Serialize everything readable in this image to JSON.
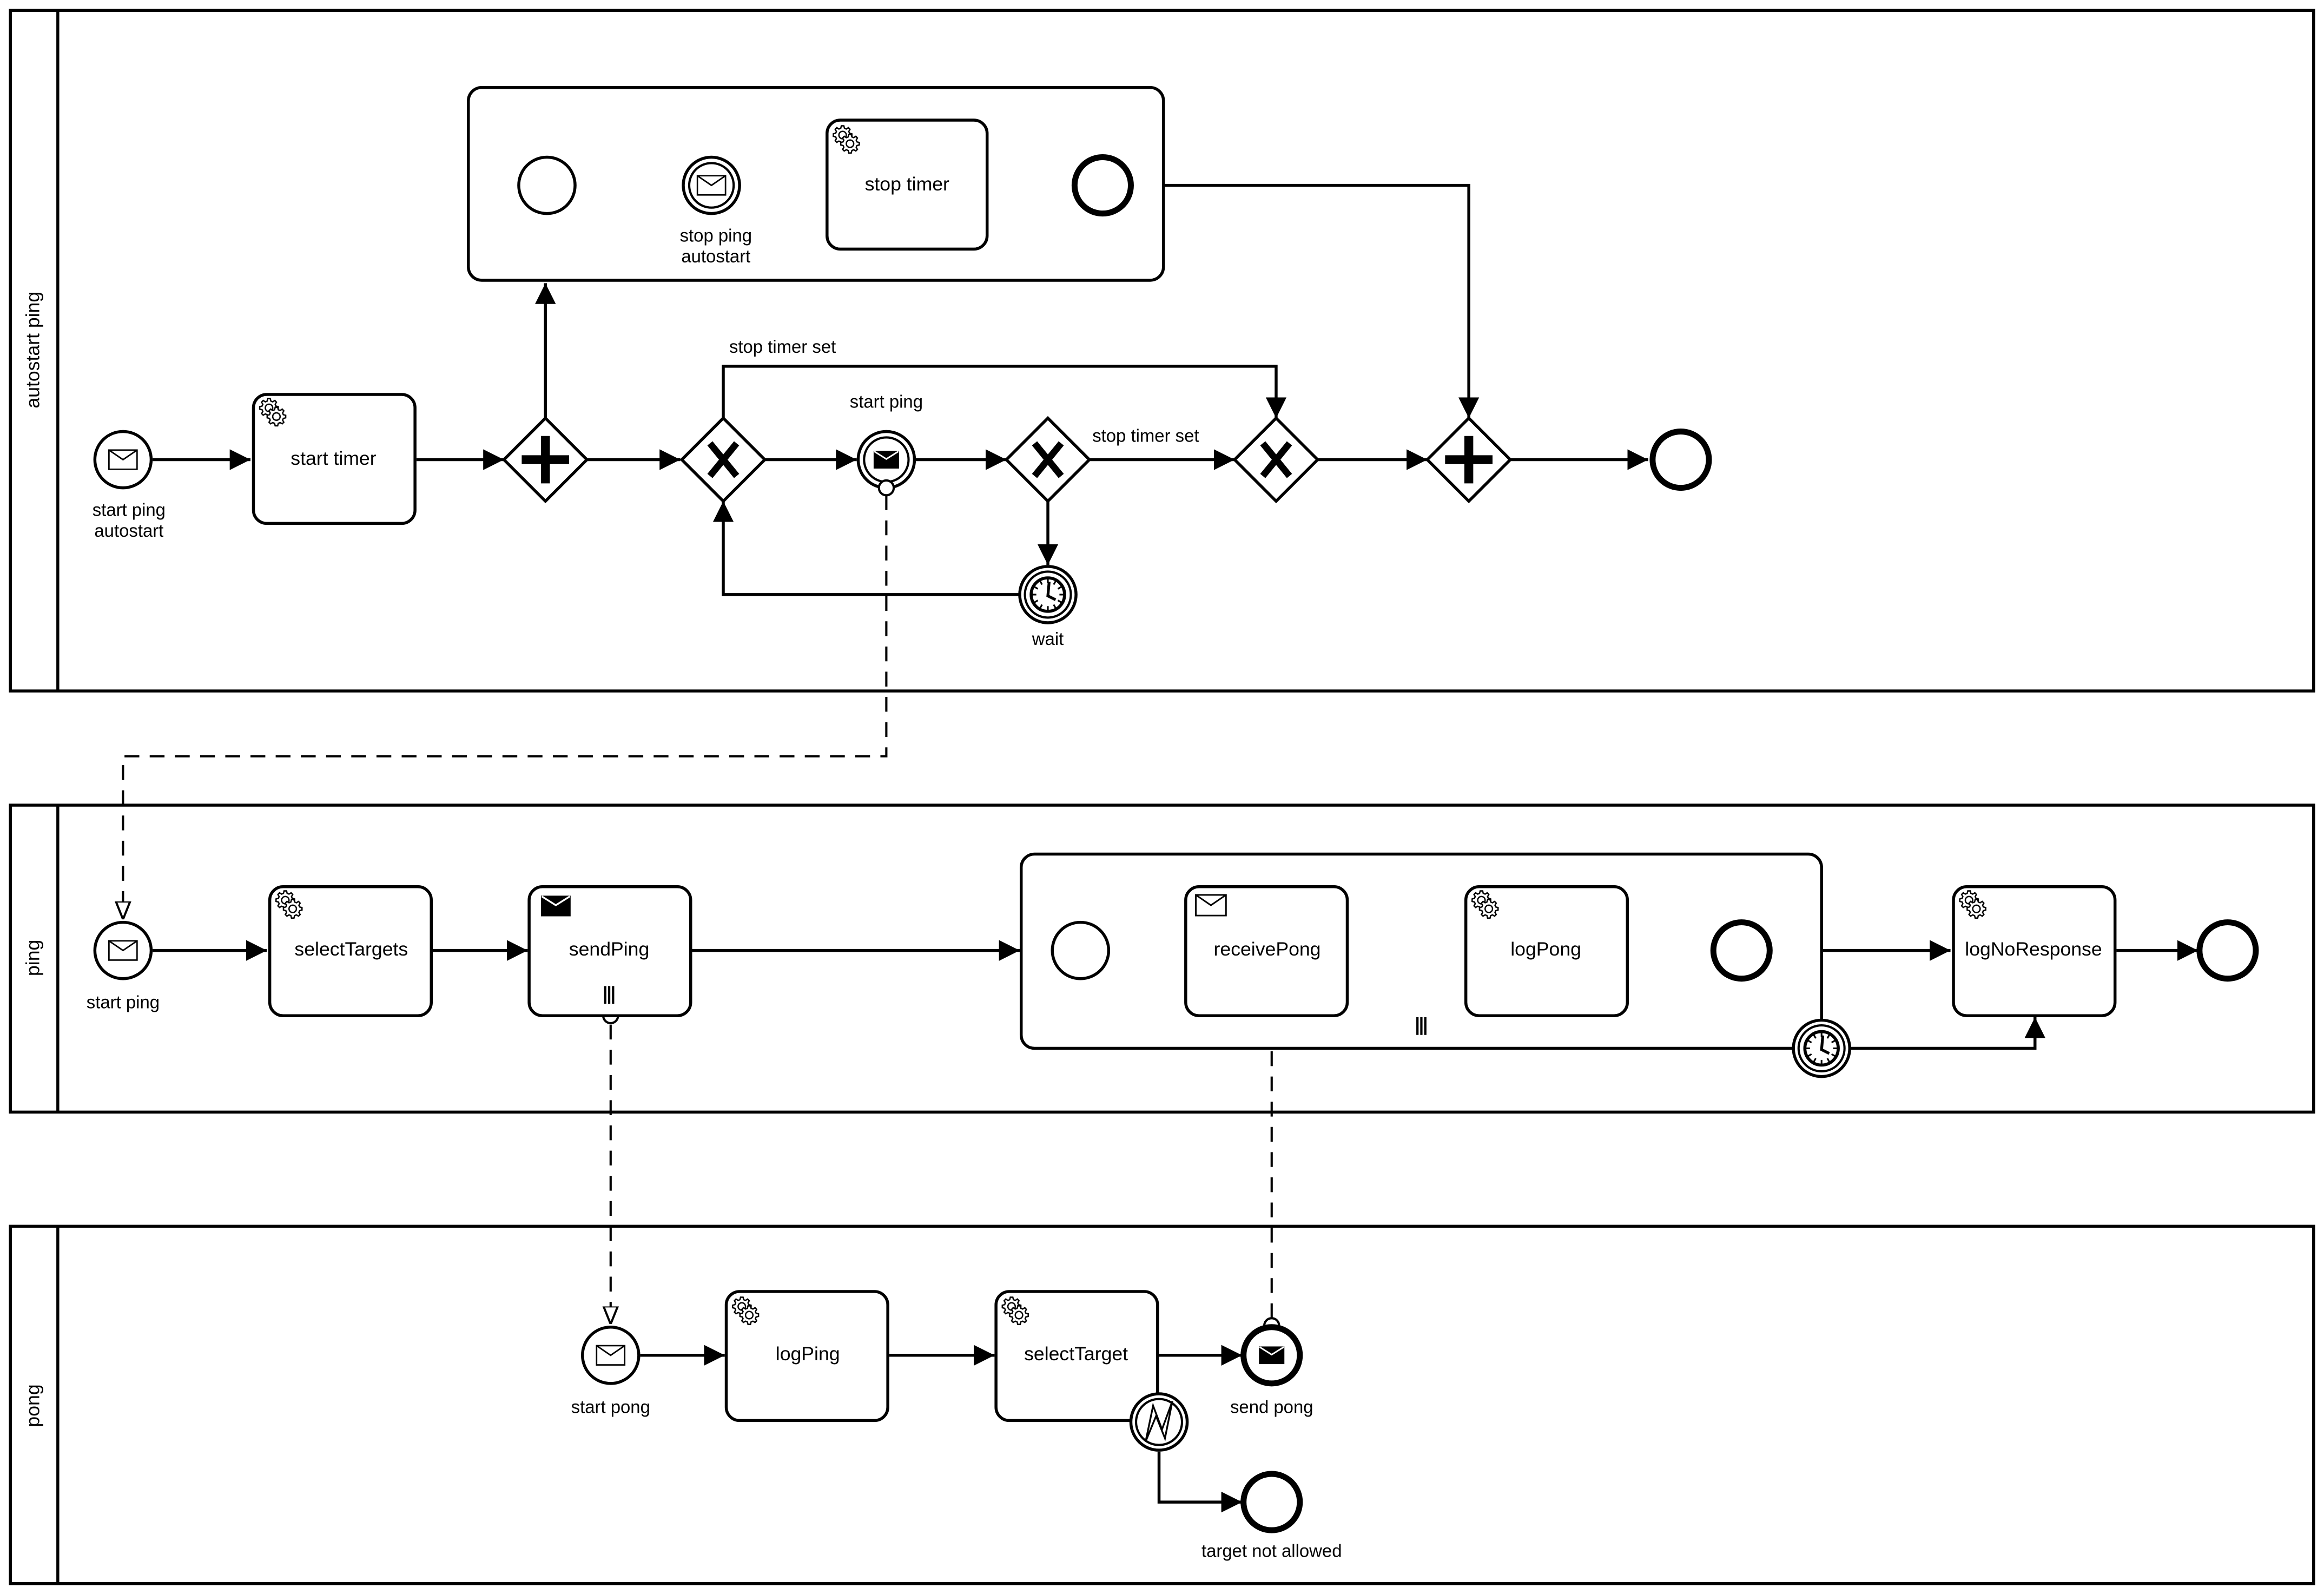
{
  "diagram": {
    "type": "BPMN collaboration",
    "colors": {
      "stroke": "#000000",
      "fill": "#ffffff"
    }
  },
  "pools": [
    {
      "id": "autostart",
      "label": "autostart ping"
    },
    {
      "id": "ping",
      "label": "ping"
    },
    {
      "id": "pong",
      "label": "pong"
    }
  ],
  "autostart": {
    "start_event": {
      "label_line1": "start ping",
      "label_line2": "autostart",
      "icon": "envelope-icon"
    },
    "start_timer": {
      "label": "start timer",
      "icon": "gear-icon"
    },
    "subprocess": {
      "catch_event": {
        "label_line1": "stop ping",
        "label_line2": "autostart",
        "icon": "envelope-icon"
      },
      "stop_timer": {
        "label": "stop timer",
        "icon": "gear-icon"
      }
    },
    "flow_label_top": "stop timer set",
    "flow_label_right": "stop timer set",
    "throw_event": {
      "label": "start ping",
      "icon": "filled-envelope-icon"
    },
    "timer_event": {
      "label": "wait",
      "icon": "clock-icon"
    }
  },
  "ping": {
    "start_event": {
      "label": "start ping",
      "icon": "envelope-icon"
    },
    "select_targets": {
      "label": "selectTargets",
      "icon": "gear-icon"
    },
    "send_ping": {
      "label": "sendPing",
      "icon": "filled-envelope-icon",
      "marker": "parallel-multi-instance"
    },
    "subprocess": {
      "receive_pong": {
        "label": "receivePong",
        "icon": "envelope-icon"
      },
      "log_pong": {
        "label": "logPong",
        "icon": "gear-icon"
      },
      "marker": "parallel-multi-instance"
    },
    "log_no_response": {
      "label": "logNoResponse",
      "icon": "gear-icon"
    }
  },
  "pong": {
    "start_event": {
      "label": "start pong",
      "icon": "envelope-icon"
    },
    "log_ping": {
      "label": "logPing",
      "icon": "gear-icon"
    },
    "select_target": {
      "label": "selectTarget",
      "icon": "gear-icon"
    },
    "send_pong": {
      "label": "send pong",
      "icon": "filled-envelope-icon"
    },
    "error_end": {
      "label": "target not allowed"
    },
    "error_boundary": {
      "icon": "error-icon"
    }
  }
}
